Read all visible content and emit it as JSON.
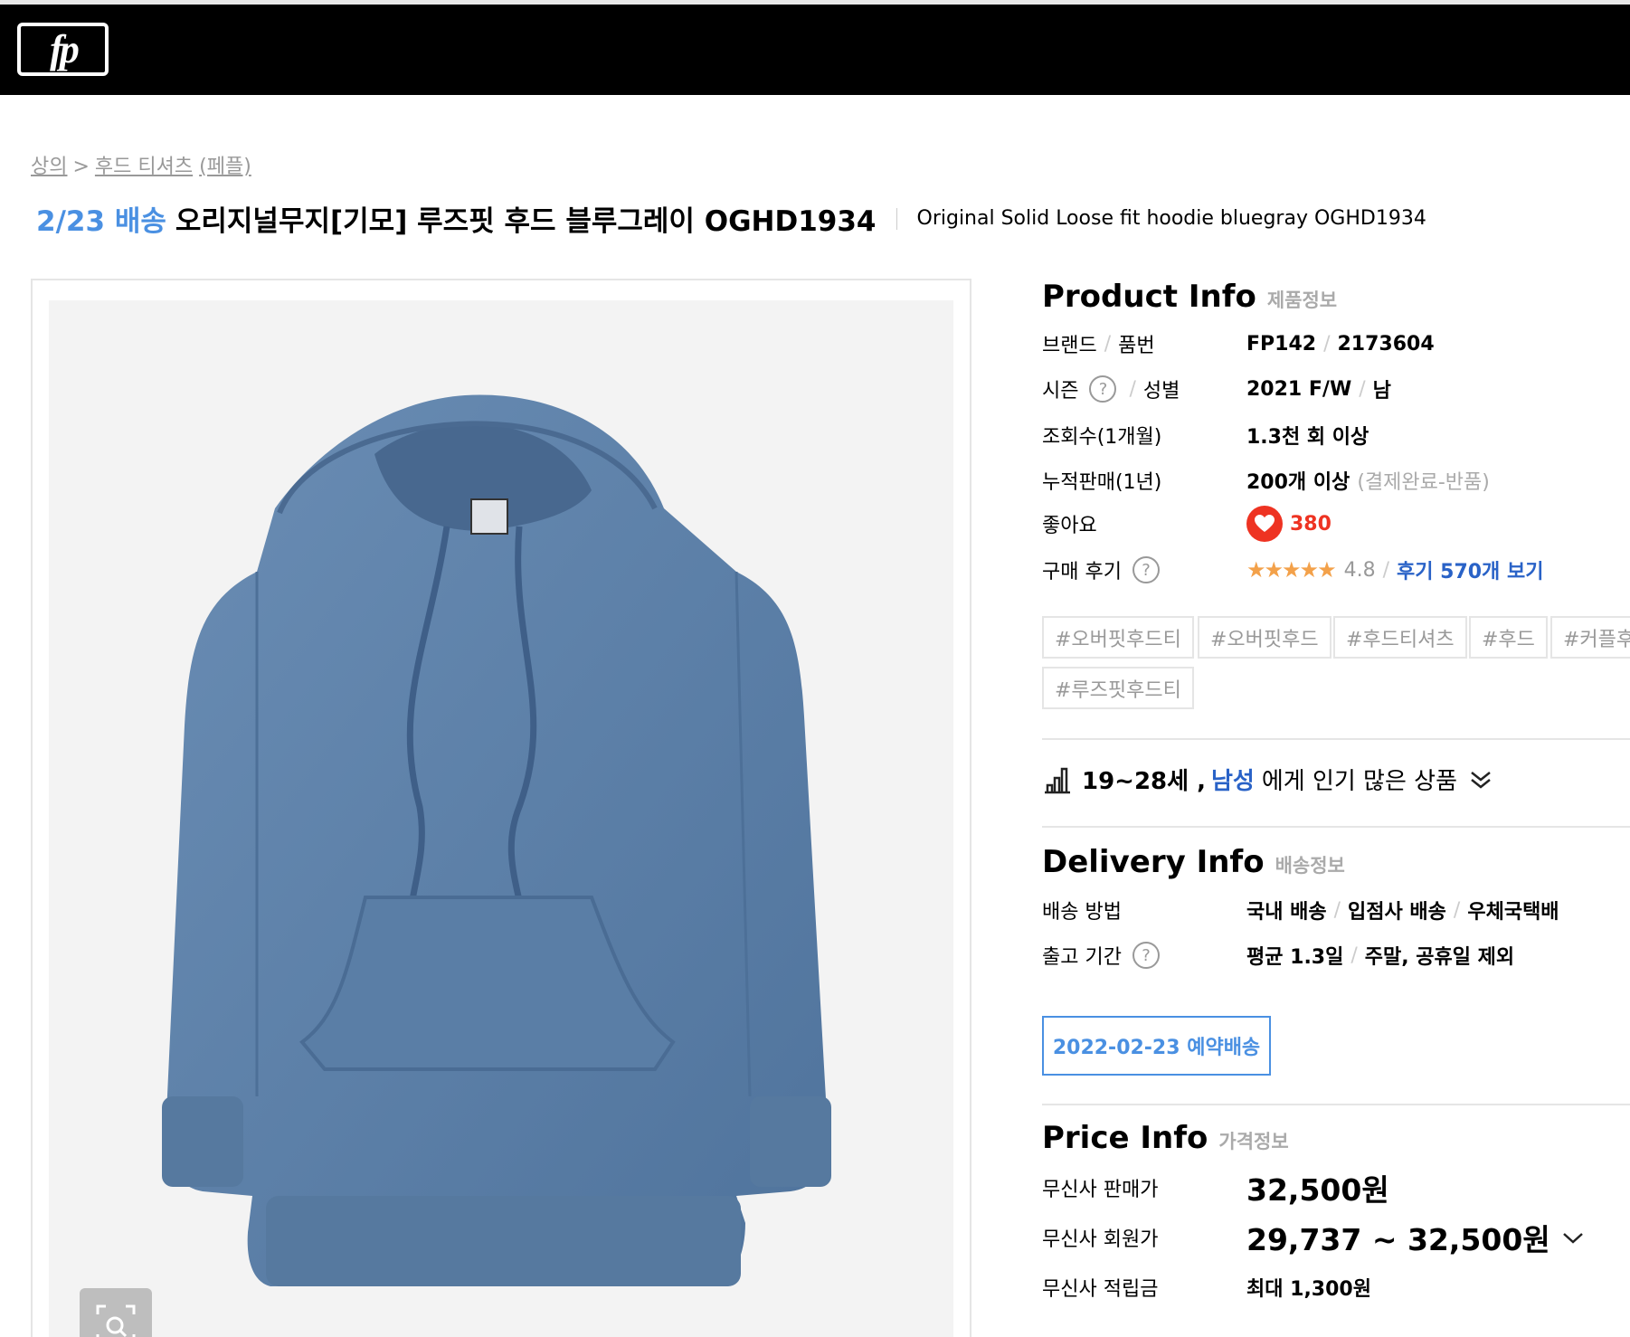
{
  "header": {
    "logo_text": "fp"
  },
  "breadcrumb": {
    "category": "상의",
    "separator": ">",
    "subcategory": "후드 티셔츠",
    "brand": "(페플)"
  },
  "title": {
    "delivery_date": "2/23 배송",
    "name_ko": "오리지널무지[기모] 루즈핏 후드 블루그레이 OGHD1934",
    "name_en": "Original Solid Loose fit hoodie bluegray OGHD1934"
  },
  "product_info": {
    "title_en": "Product Info",
    "title_ko": "제품정보",
    "brand_label": "브랜드",
    "sku_label": "품번",
    "brand_value": "FP142",
    "sku_value": "2173604",
    "season_label": "시즌",
    "gender_label": "성별",
    "season_value": "2021 F/W",
    "gender_value": "남",
    "views_label": "조회수(1개월)",
    "views_value": "1.3천 회 이상",
    "sales_label": "누적판매(1년)",
    "sales_value": "200개 이상",
    "sales_note": "(결제완료-반품)",
    "likes_label": "좋아요",
    "likes_value": "380",
    "review_label": "구매 후기",
    "stars": "★★★★★",
    "rating": "4.8",
    "review_link": "후기 570개 보기",
    "qmark": "?",
    "slash": "/",
    "tags": [
      "#오버핏후드티",
      "#오버핏후드",
      "#후드티셔츠",
      "#후드",
      "#커플후",
      "#루즈핏후드티"
    ]
  },
  "popular": {
    "age": "19~28세 ,",
    "gender": "남성",
    "rest": "에게 인기 많은 상품"
  },
  "delivery_info": {
    "title_en": "Delivery Info",
    "title_ko": "배송정보",
    "method_label": "배송 방법",
    "method_1": "국내 배송",
    "method_2": "입점사 배송",
    "method_3": "우체국택배",
    "ship_label": "출고 기간",
    "ship_1": "평균 1.3일",
    "ship_2": "주말, 공휴일 제외",
    "reserve_button": "2022-02-23 예약배송"
  },
  "price_info": {
    "title_en": "Price Info",
    "title_ko": "가격정보",
    "sale_label": "무신사 판매가",
    "sale_value": "32,500원",
    "member_label": "무신사 회원가",
    "member_value": "29,737 ~ 32,500원",
    "points_label": "무신사 적립금",
    "points_value": "최대 1,300원"
  },
  "colors": {
    "accent_blue": "#4a90e2",
    "link_blue": "#2962c7",
    "like_red": "#e33322",
    "star_orange": "#f3a14a",
    "hoodie": "#5b7fa6"
  }
}
